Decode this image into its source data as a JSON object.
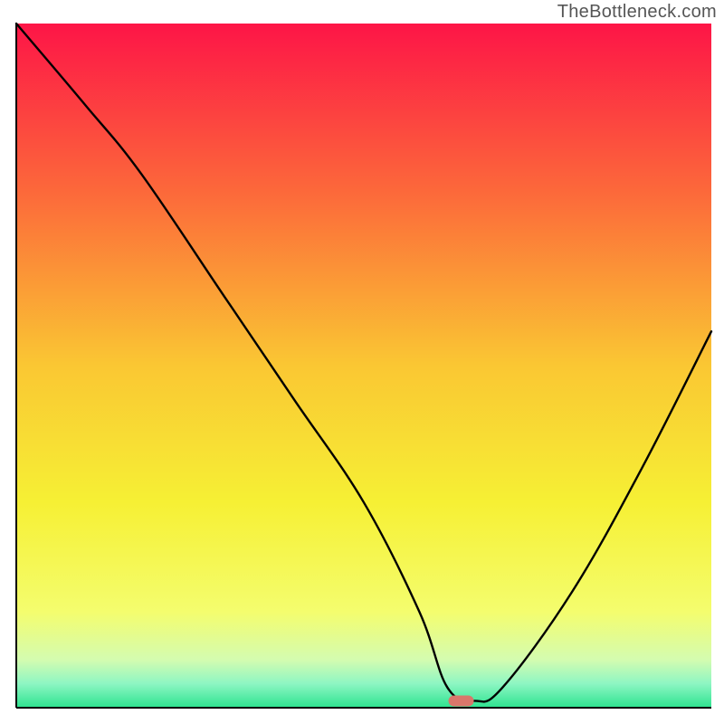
{
  "watermark": "TheBottleneck.com",
  "chart_data": {
    "type": "line",
    "title": "",
    "xlabel": "",
    "ylabel": "",
    "xlim": [
      0,
      100
    ],
    "ylim": [
      0,
      100
    ],
    "grid": false,
    "legend": null,
    "annotations": [],
    "series": [
      {
        "name": "bottleneck-curve",
        "x": [
          0,
          10,
          18,
          30,
          40,
          50,
          58,
          62,
          66,
          70,
          80,
          90,
          100
        ],
        "y": [
          100,
          88,
          78,
          60,
          45,
          30,
          14,
          3,
          1,
          3,
          17,
          35,
          55
        ]
      }
    ],
    "marker": {
      "name": "optimal-point",
      "x": 64,
      "y": 1,
      "color": "#d9766b"
    },
    "background_gradient": {
      "stops": [
        {
          "offset": 0.0,
          "color": "#fd1547"
        },
        {
          "offset": 0.25,
          "color": "#fc6a3a"
        },
        {
          "offset": 0.5,
          "color": "#fac733"
        },
        {
          "offset": 0.7,
          "color": "#f6f034"
        },
        {
          "offset": 0.86,
          "color": "#f4fd6e"
        },
        {
          "offset": 0.93,
          "color": "#d4fcb0"
        },
        {
          "offset": 0.965,
          "color": "#8df6c3"
        },
        {
          "offset": 1.0,
          "color": "#2de38f"
        }
      ]
    }
  }
}
